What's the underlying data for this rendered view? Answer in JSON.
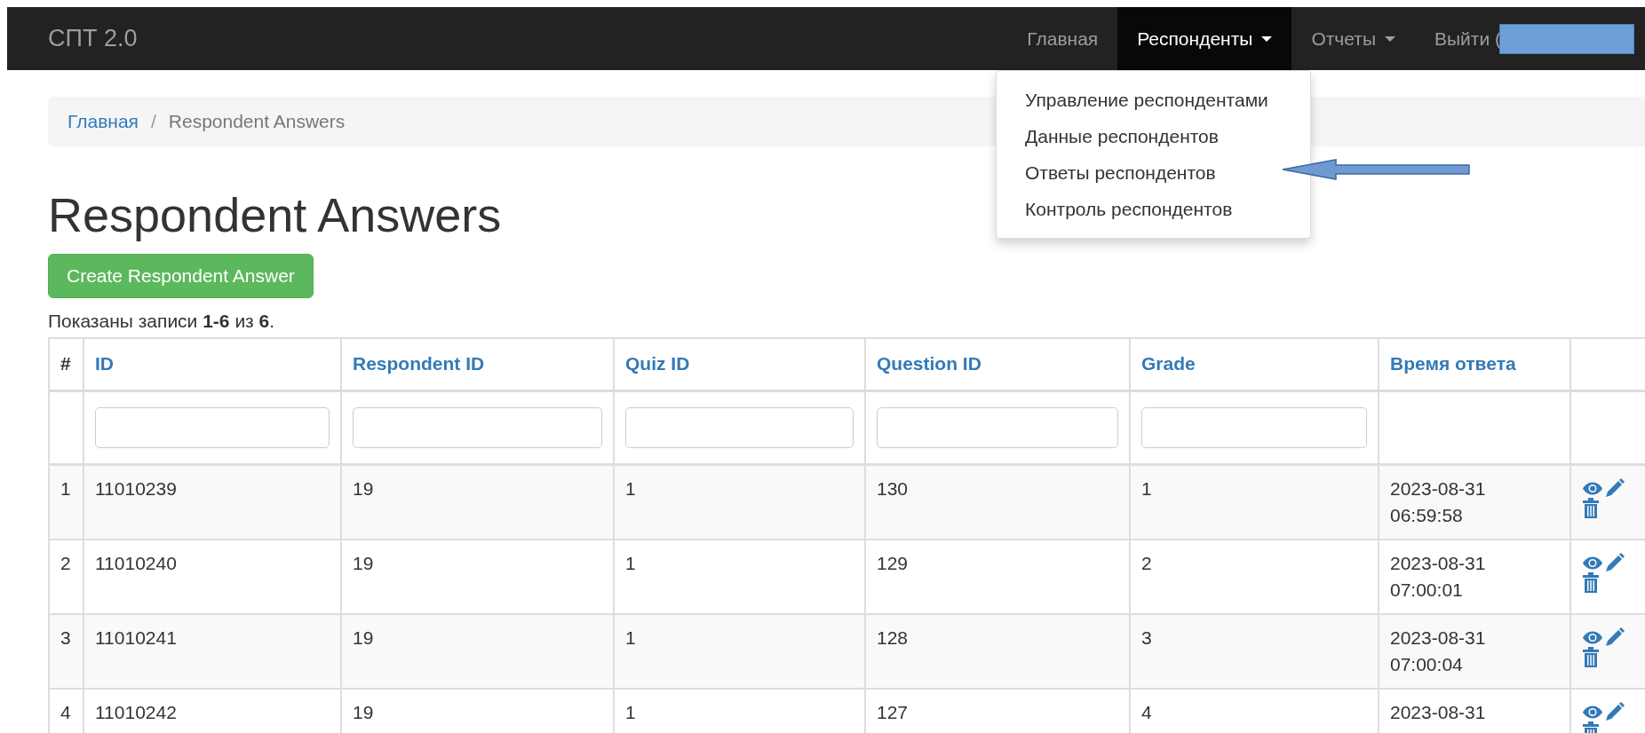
{
  "navbar": {
    "brand": "СПТ 2.0",
    "items": [
      {
        "label": "Главная",
        "selected": false,
        "dropdown": false,
        "redacted": false
      },
      {
        "label": "Респонденты",
        "selected": true,
        "dropdown": true,
        "redacted": false
      },
      {
        "label": "Отчеты",
        "selected": false,
        "dropdown": true,
        "redacted": false
      },
      {
        "label": "Выйти (",
        "selected": false,
        "dropdown": false,
        "redacted": true
      }
    ]
  },
  "dropdown_menu": {
    "items": [
      {
        "label": "Управление респондентами"
      },
      {
        "label": "Данные респондентов"
      },
      {
        "label": "Ответы респондентов"
      },
      {
        "label": "Контроль респондентов"
      }
    ],
    "annotation_arrow": true
  },
  "breadcrumb": {
    "separator": "/",
    "items": [
      {
        "label": "Главная",
        "link": true
      },
      {
        "label": "Respondent Answers",
        "link": false
      }
    ]
  },
  "title": "Respondent Answers",
  "create_button": "Create Respondent Answer",
  "summary": "Показаны записи **1-6** из **6**.",
  "table": {
    "columns": [
      {
        "label": "#",
        "link": false,
        "filter": false
      },
      {
        "label": "ID",
        "link": true,
        "filter": true
      },
      {
        "label": "Respondent ID",
        "link": true,
        "filter": true
      },
      {
        "label": "Quiz ID",
        "link": true,
        "filter": true
      },
      {
        "label": "Question ID",
        "link": true,
        "filter": true
      },
      {
        "label": "Grade",
        "link": true,
        "filter": true
      },
      {
        "label": "Время ответа",
        "link": true,
        "filter": false
      }
    ],
    "rows": [
      {
        "cells": [
          "1",
          "11010239",
          "19",
          "1",
          "130",
          "1",
          "2023-08-31 06:59:58"
        ]
      },
      {
        "cells": [
          "2",
          "11010240",
          "19",
          "1",
          "129",
          "2",
          "2023-08-31 07:00:01"
        ]
      },
      {
        "cells": [
          "3",
          "11010241",
          "19",
          "1",
          "128",
          "3",
          "2023-08-31 07:00:04"
        ]
      },
      {
        "cells": [
          "4",
          "11010242",
          "19",
          "1",
          "127",
          "4",
          "2023-08-31"
        ]
      }
    ]
  }
}
